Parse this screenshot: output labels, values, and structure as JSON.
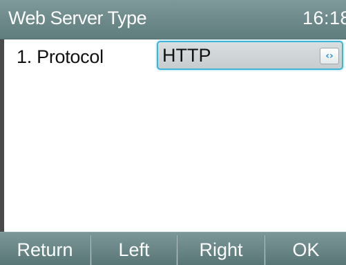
{
  "header": {
    "title": "Web Server Type",
    "clock": "16:18"
  },
  "form": {
    "rows": [
      {
        "label": "1. Protocol",
        "value": "HTTP",
        "switch_icon": "left-right-arrows-icon"
      }
    ]
  },
  "softkeys": [
    {
      "label": "Return"
    },
    {
      "label": "Left"
    },
    {
      "label": "Right"
    },
    {
      "label": "OK"
    }
  ],
  "colors": {
    "title_bar": "#6f8b8c",
    "focus_border": "#3fb4d6",
    "switch_icon": "#2a8fd4"
  }
}
